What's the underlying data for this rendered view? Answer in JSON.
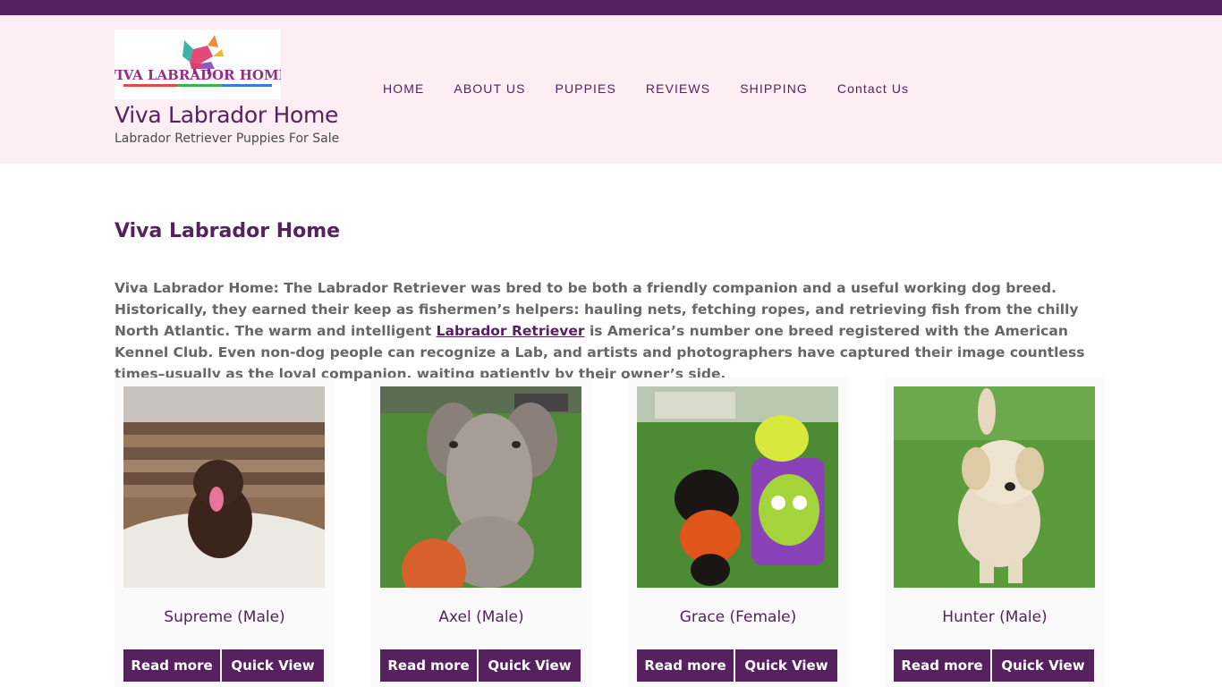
{
  "header": {
    "logo_text": "VIVA LABRADOR HOME",
    "site_title": "Viva Labrador Home",
    "tagline": "Labrador Retriever Puppies For Sale"
  },
  "nav": {
    "items": [
      {
        "label": "HOME"
      },
      {
        "label": "ABOUT US"
      },
      {
        "label": "PUPPIES"
      },
      {
        "label": "REVIEWS"
      },
      {
        "label": "SHIPPING"
      },
      {
        "label": "Contact Us"
      }
    ]
  },
  "main": {
    "title": "Viva Labrador Home",
    "intro_before": "Viva Labrador Home: The Labrador Retriever was bred to be both a friendly companion and a useful working dog breed. Historically, they earned their keep as fishermen’s helpers: hauling nets, fetching ropes, and retrieving fish from the chilly North Atlantic. The warm and intelligent ",
    "intro_link": "Labrador Retriever",
    "intro_after": " is America’s number one breed registered with the American Kennel Club. Even non-dog people can recognize a Lab, and artists and photographers have captured their image countless times–usually as the loyal companion, waiting patiently by their owner’s side."
  },
  "products": [
    {
      "name": "Supreme (Male)",
      "read_more": "Read more",
      "quick_view": "Quick View"
    },
    {
      "name": "Axel (Male)",
      "read_more": "Read more",
      "quick_view": "Quick View"
    },
    {
      "name": "Grace (Female)",
      "read_more": "Read more",
      "quick_view": "Quick View"
    },
    {
      "name": "Hunter (Male)",
      "read_more": "Read more",
      "quick_view": "Quick View"
    }
  ],
  "colors": {
    "brand": "#55215f",
    "header_bg": "#fdeef3",
    "card_bg": "#fafafa"
  }
}
